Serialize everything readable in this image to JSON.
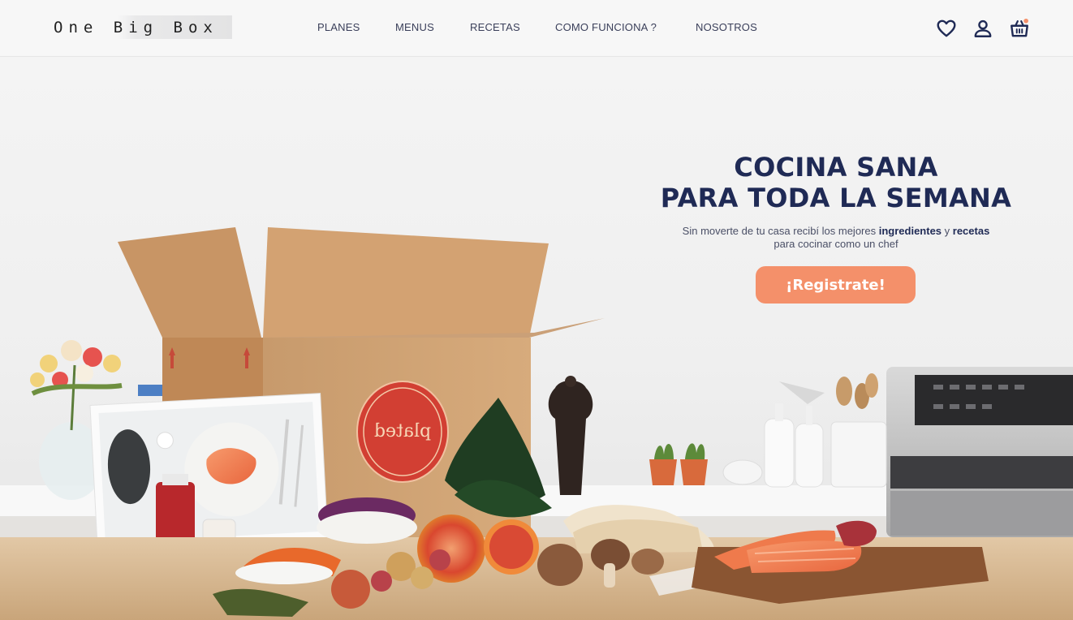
{
  "header": {
    "logo": "One Big Box",
    "nav": [
      "PLANES",
      "MENUS",
      "RECETAS",
      "COMO FUNCIONA ?",
      "NOSOTROS"
    ],
    "icons": {
      "favorites": "heart-icon",
      "account": "user-icon",
      "cart": "basket-icon"
    },
    "cart_badge_color": "#f4906a"
  },
  "hero": {
    "title_line1": "COCINA SANA",
    "title_line2": "PARA TODA LA SEMANA",
    "subtitle_part1": "Sin moverte de tu casa recibí los mejores ",
    "subtitle_bold1": "ingredientes",
    "subtitle_part2": " y ",
    "subtitle_bold2": "recetas",
    "subtitle_line2": "para cocinar como un chef",
    "cta_label": "¡Registrate!",
    "box_logo": "plated",
    "accent_color": "#f4906a",
    "title_color": "#1f2a55"
  }
}
